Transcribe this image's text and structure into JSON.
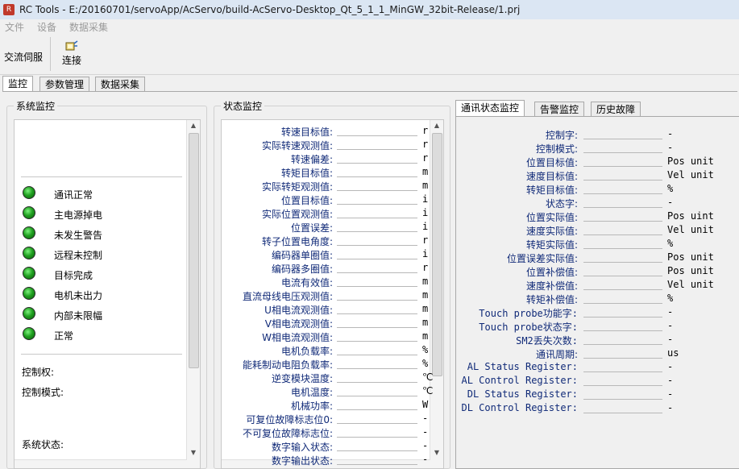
{
  "window": {
    "title": "RC Tools - E:/20160701/servoApp/AcServo/build-AcServo-Desktop_Qt_5_1_1_MinGW_32bit-Release/1.prj"
  },
  "menu": [
    "文件",
    "设备",
    "数据采集"
  ],
  "toolbar": {
    "left_label": "交流伺服",
    "connect_label": "连接"
  },
  "tabs": [
    "监控",
    "参数管理",
    "数据采集"
  ],
  "system_monitor": {
    "title": "系统监控",
    "indicators": [
      "通讯正常",
      "主电源掉电",
      "未发生警告",
      "远程未控制",
      "目标完成",
      "电机未出力",
      "内部未限幅",
      "正常"
    ],
    "indicator_color": "#21a121",
    "labels": [
      "控制权:",
      "控制模式:",
      "系统状态:"
    ]
  },
  "status_monitor": {
    "title": "状态监控",
    "rows": [
      {
        "label": "转速目标值:",
        "unit": "r"
      },
      {
        "label": "实际转速观测值:",
        "unit": "r"
      },
      {
        "label": "转速偏差:",
        "unit": "r"
      },
      {
        "label": "转矩目标值:",
        "unit": "m"
      },
      {
        "label": "实际转矩观测值:",
        "unit": "m"
      },
      {
        "label": "位置目标值:",
        "unit": "i"
      },
      {
        "label": "实际位置观测值:",
        "unit": "i"
      },
      {
        "label": "位置误差:",
        "unit": "i"
      },
      {
        "label": "转子位置电角度:",
        "unit": "r"
      },
      {
        "label": "编码器单圈值:",
        "unit": "i"
      },
      {
        "label": "编码器多圈值:",
        "unit": "r"
      },
      {
        "label": "电流有效值:",
        "unit": "m"
      },
      {
        "label": "直流母线电压观测值:",
        "unit": "m"
      },
      {
        "label": "U相电流观测值:",
        "unit": "m"
      },
      {
        "label": "V相电流观测值:",
        "unit": "m"
      },
      {
        "label": "W相电流观测值:",
        "unit": "m"
      },
      {
        "label": "电机负载率:",
        "unit": "%"
      },
      {
        "label": "能耗制动电阻负载率:",
        "unit": "%"
      },
      {
        "label": "逆变模块温度:",
        "unit": "℃"
      },
      {
        "label": "电机温度:",
        "unit": "℃"
      },
      {
        "label": "机械功率:",
        "unit": "W"
      },
      {
        "label": "可复位故障标志位0:",
        "unit": "-"
      },
      {
        "label": "不可复位故障标志位:",
        "unit": "-"
      },
      {
        "label": "数字输入状态:",
        "unit": "-"
      },
      {
        "label": "数字输出状态:",
        "unit": "-"
      }
    ]
  },
  "comm_panel": {
    "tabs": [
      "通讯状态监控",
      "告警监控",
      "历史故障"
    ],
    "rows": [
      {
        "label": "控制字:",
        "unit": "-"
      },
      {
        "label": "控制模式:",
        "unit": "-"
      },
      {
        "label": "位置目标值:",
        "unit": "Pos unit"
      },
      {
        "label": "速度目标值:",
        "unit": "Vel unit"
      },
      {
        "label": "转矩目标值:",
        "unit": "%"
      },
      {
        "label": "状态字:",
        "unit": "-"
      },
      {
        "label": "位置实际值:",
        "unit": "Pos uint"
      },
      {
        "label": "速度实际值:",
        "unit": "Vel unit"
      },
      {
        "label": "转矩实际值:",
        "unit": "%"
      },
      {
        "label": "位置误差实际值:",
        "unit": "Pos unit"
      },
      {
        "label": "位置补偿值:",
        "unit": "Pos unit"
      },
      {
        "label": "速度补偿值:",
        "unit": "Vel unit"
      },
      {
        "label": "转矩补偿值:",
        "unit": "%"
      },
      {
        "label": "Touch probe功能字:",
        "unit": "-"
      },
      {
        "label": "Touch probe状态字:",
        "unit": "-"
      },
      {
        "label": "SM2丢失次数:",
        "unit": "-"
      },
      {
        "label": "通讯周期:",
        "unit": "us"
      },
      {
        "label": "AL Status Register:",
        "unit": "-"
      },
      {
        "label": "AL Control Register:",
        "unit": "-"
      },
      {
        "label": "DL Status Register:",
        "unit": "-"
      },
      {
        "label": "DL Control Register:",
        "unit": "-"
      }
    ]
  }
}
